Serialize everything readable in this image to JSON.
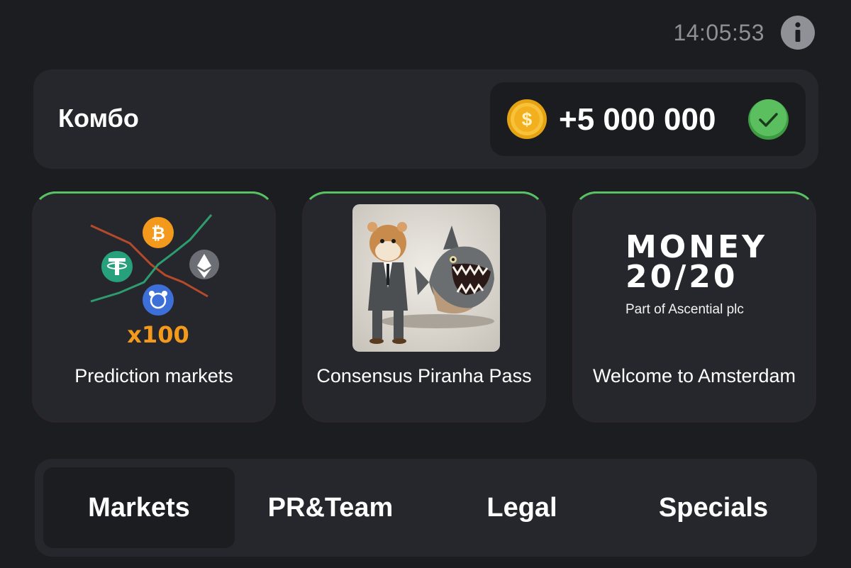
{
  "status": {
    "time": "14:05:53"
  },
  "combo": {
    "title": "Комбо",
    "reward": "+5 000 000",
    "coin_symbol": "$"
  },
  "cards": [
    {
      "label": "Prediction markets",
      "badge": "x100"
    },
    {
      "label": "Consensus Piranha Pass"
    },
    {
      "label": "Welcome to Amsterdam",
      "logo_line1": "MONEY",
      "logo_line2": "20/20",
      "logo_sub": "Part of Ascential plc"
    }
  ],
  "tabs": [
    {
      "label": "Markets",
      "active": true
    },
    {
      "label": "PR&Team",
      "active": false
    },
    {
      "label": "Legal",
      "active": false
    },
    {
      "label": "Specials",
      "active": false
    }
  ],
  "colors": {
    "background": "#1c1d21",
    "panel": "#26272c",
    "accent_green": "#4fb65a",
    "coin_gold": "#f5b81b",
    "check_green": "#4caf50"
  },
  "icons": [
    "info-icon",
    "coin-icon",
    "check-icon",
    "bitcoin-icon",
    "tether-icon",
    "ethereum-icon",
    "hamster-icon"
  ]
}
